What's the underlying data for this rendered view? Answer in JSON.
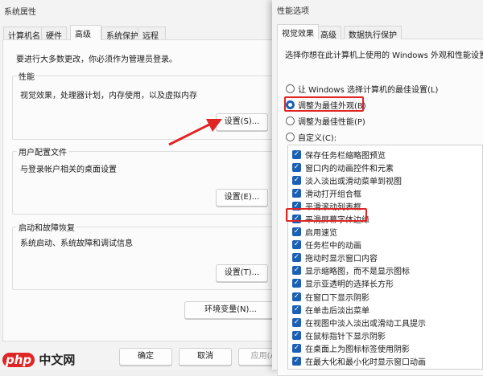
{
  "system_properties": {
    "title": "系统属性",
    "tabs": [
      "计算机名",
      "硬件",
      "高级",
      "系统保护",
      "远程"
    ],
    "notice": "要进行大多数更改，你必须作为管理员登录。",
    "performance": {
      "legend": "性能",
      "desc": "视觉效果，处理器计划，内存使用，以及虚拟内存",
      "button": "设置(S)..."
    },
    "user_profiles": {
      "legend": "用户配置文件",
      "desc": "与登录帐户相关的桌面设置",
      "button": "设置(E)..."
    },
    "startup": {
      "legend": "启动和故障恢复",
      "desc": "系统启动、系统故障和调试信息",
      "button": "设置(T)..."
    },
    "env_button": "环境变量(N)...",
    "ok": "确定",
    "cancel": "取消",
    "apply": "应用(A)"
  },
  "performance_options": {
    "title": "性能选项",
    "tabs": [
      "视觉效果",
      "高级",
      "数据执行保护"
    ],
    "desc": "选择你想在此计算机上使用的 Windows 外观和性能设置。",
    "radios": [
      {
        "label": "让 Windows 选择计算机的最佳设置(L)",
        "checked": false
      },
      {
        "label": "调整为最佳外观(B)",
        "checked": true
      },
      {
        "label": "调整为最佳性能(P)",
        "checked": false
      },
      {
        "label": "自定义(C):",
        "checked": false
      }
    ],
    "effects": [
      "保存任务栏缩略图预览",
      "窗口内的动画控件和元素",
      "淡入淡出或滑动菜单到视图",
      "滑动打开组合框",
      "平滑滚动列表框",
      "平滑屏幕字体边缘",
      "启用速览",
      "任务栏中的动画",
      "拖动时显示窗口内容",
      "显示缩略图，而不是显示图标",
      "显示亚透明的选择长方形",
      "在窗口下显示阴影",
      "在单击后淡出菜单",
      "在视图中淡入淡出或滑动工具提示",
      "在鼠标指针下显示阴影",
      "在桌面上为图标标签使用阴影",
      "在最大化和最小化时显示窗口动画"
    ]
  },
  "watermark": "php中文网",
  "colors": {
    "accent": "#1a5fb4",
    "highlight": "#e02525"
  }
}
